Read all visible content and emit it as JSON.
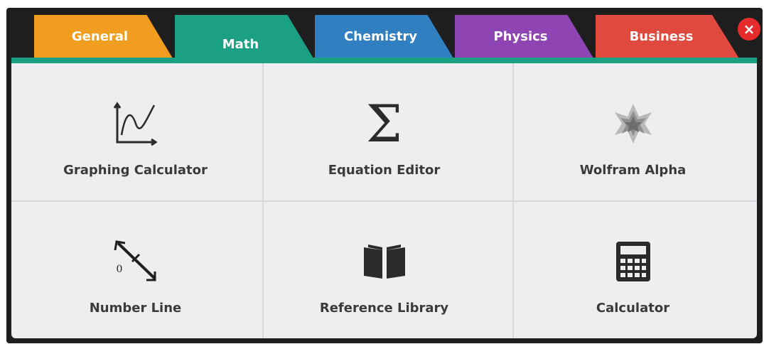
{
  "colors": {
    "general": "#f09d20",
    "math": "#1ba084",
    "chemistry": "#2f7fc1",
    "physics": "#8e44b3",
    "business": "#e04a3e",
    "close": "#e52b2b"
  },
  "tabs": [
    {
      "label": "General"
    },
    {
      "label": "Math"
    },
    {
      "label": "Chemistry"
    },
    {
      "label": "Physics"
    },
    {
      "label": "Business"
    }
  ],
  "active_tab": "Math",
  "close_icon": "×",
  "tools": [
    {
      "label": "Graphing Calculator",
      "icon": "graph-icon"
    },
    {
      "label": "Equation Editor",
      "icon": "sigma-icon"
    },
    {
      "label": "Wolfram Alpha",
      "icon": "wolfram-icon"
    },
    {
      "label": "Number Line",
      "icon": "number-line-icon"
    },
    {
      "label": "Reference Library",
      "icon": "book-icon"
    },
    {
      "label": "Calculator",
      "icon": "calculator-icon"
    }
  ],
  "number_line_zero": "0",
  "sigma_symbol": "Σ"
}
